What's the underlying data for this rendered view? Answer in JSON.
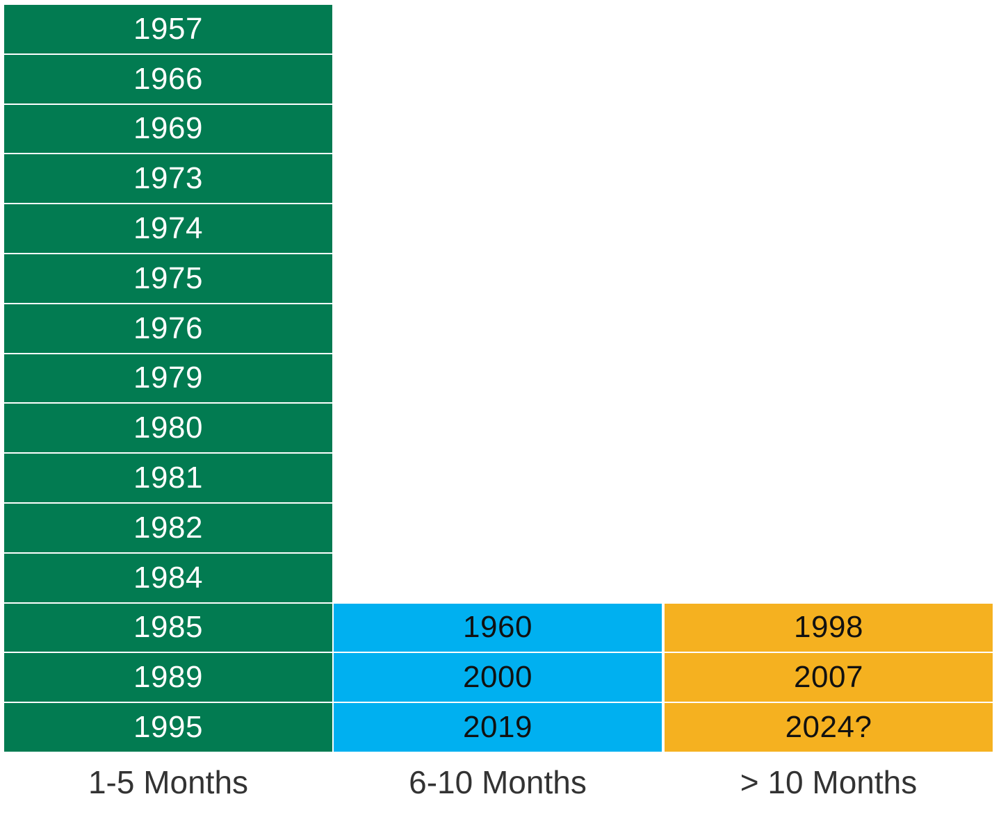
{
  "chart_data": {
    "type": "table",
    "title": "",
    "xlabel": "",
    "ylabel": "",
    "categories": [
      "1-5 Months",
      "6-10 Months",
      "> 10 Months"
    ],
    "series": [
      {
        "name": "1-5 Months",
        "color": "#027B51",
        "text_color": "#ffffff",
        "values": [
          "1957",
          "1966",
          "1969",
          "1973",
          "1974",
          "1975",
          "1976",
          "1979",
          "1980",
          "1981",
          "1982",
          "1984",
          "1985",
          "1989",
          "1995"
        ]
      },
      {
        "name": "6-10 Months",
        "color": "#00B0F0",
        "text_color": "#111111",
        "values": [
          "1960",
          "2000",
          "2019"
        ]
      },
      {
        "name": "> 10 Months",
        "color": "#F5B120",
        "text_color": "#111111",
        "values": [
          "1998",
          "2007",
          "2024?"
        ]
      }
    ],
    "counts": [
      15,
      3,
      3
    ]
  }
}
